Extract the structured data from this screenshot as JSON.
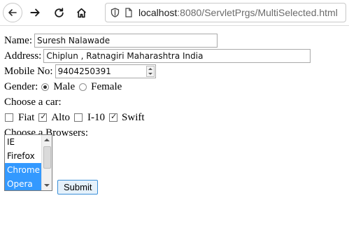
{
  "browser": {
    "url_host": "localhost",
    "url_path": ":8080/ServletPrgs/MultiSelected.html",
    "icons": [
      "back-icon",
      "forward-icon",
      "reload-icon",
      "home-icon",
      "shield-icon",
      "page-icon"
    ]
  },
  "form": {
    "name_label": "Name:",
    "name_value": "Suresh Nalawade",
    "address_label": "Address:",
    "address_value": "Chiplun , Ratnagiri Maharashtra India",
    "mobile_label": "Mobile No:",
    "mobile_value": "9404250391",
    "gender_label": "Gender:",
    "gender_options": [
      {
        "label": "Male",
        "checked": true
      },
      {
        "label": "Female",
        "checked": false
      }
    ],
    "car_label": "Choose a car:",
    "car_options": [
      {
        "label": "Fiat",
        "checked": false
      },
      {
        "label": "Alto",
        "checked": true
      },
      {
        "label": "I-10",
        "checked": false
      },
      {
        "label": "Swift",
        "checked": true
      }
    ],
    "browser_label": "Choose a Browsers:",
    "browser_options": [
      {
        "label": "IE",
        "selected": false
      },
      {
        "label": "Firefox",
        "selected": false
      },
      {
        "label": "Chrome",
        "selected": true
      },
      {
        "label": "Opera",
        "selected": true
      }
    ],
    "submit_label": "Submit"
  }
}
